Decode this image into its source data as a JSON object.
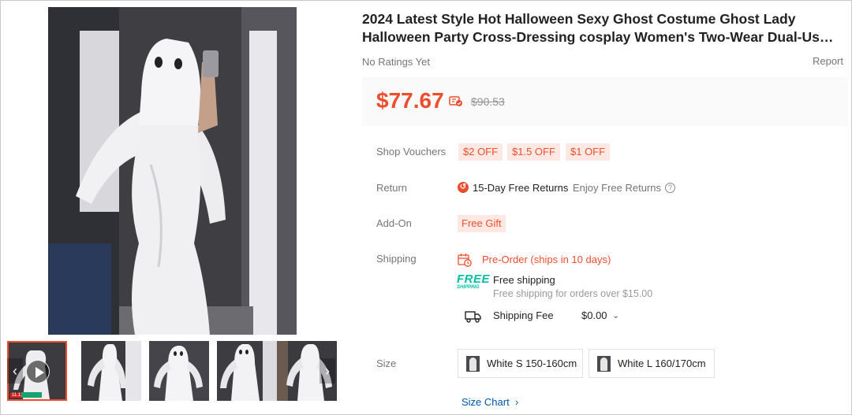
{
  "product": {
    "title_line1": "2024 Latest Style Hot Halloween Sexy Ghost Costume Ghost Lady",
    "title_line2": "Halloween Party Cross-Dressing cosplay Women's Two-Wear Dual-Use...",
    "ratings": "No Ratings Yet",
    "report": "Report"
  },
  "price": {
    "current": "$77.67",
    "original": "$90.53",
    "icon": "discount-tag-icon"
  },
  "vouchers": {
    "label": "Shop Vouchers",
    "items": [
      "$2 OFF",
      "$1.5 OFF",
      "$1 OFF"
    ]
  },
  "return": {
    "label": "Return",
    "policy": "15-Day Free Returns",
    "enjoy": "Enjoy Free Returns",
    "icon": "return-icon"
  },
  "addon": {
    "label": "Add-On",
    "gift": "Free Gift"
  },
  "shipping": {
    "label": "Shipping",
    "preorder": "Pre-Order (ships in 10 days)",
    "free_badge_top": "FREE",
    "free_badge_bottom": "SHIPPING",
    "free_title": "Free shipping",
    "free_sub": "Free shipping for orders over $15.00",
    "fee_label": "Shipping Fee",
    "fee_value": "$0.00"
  },
  "size": {
    "label": "Size",
    "options": [
      "White S 150-160cm",
      "White L 160/170cm"
    ],
    "chart_link": "Size Chart"
  },
  "colors": {
    "accent": "#ee4d2d",
    "accent_bg": "#fde9e4",
    "teal": "#00bfa5",
    "link": "#0055aa"
  }
}
